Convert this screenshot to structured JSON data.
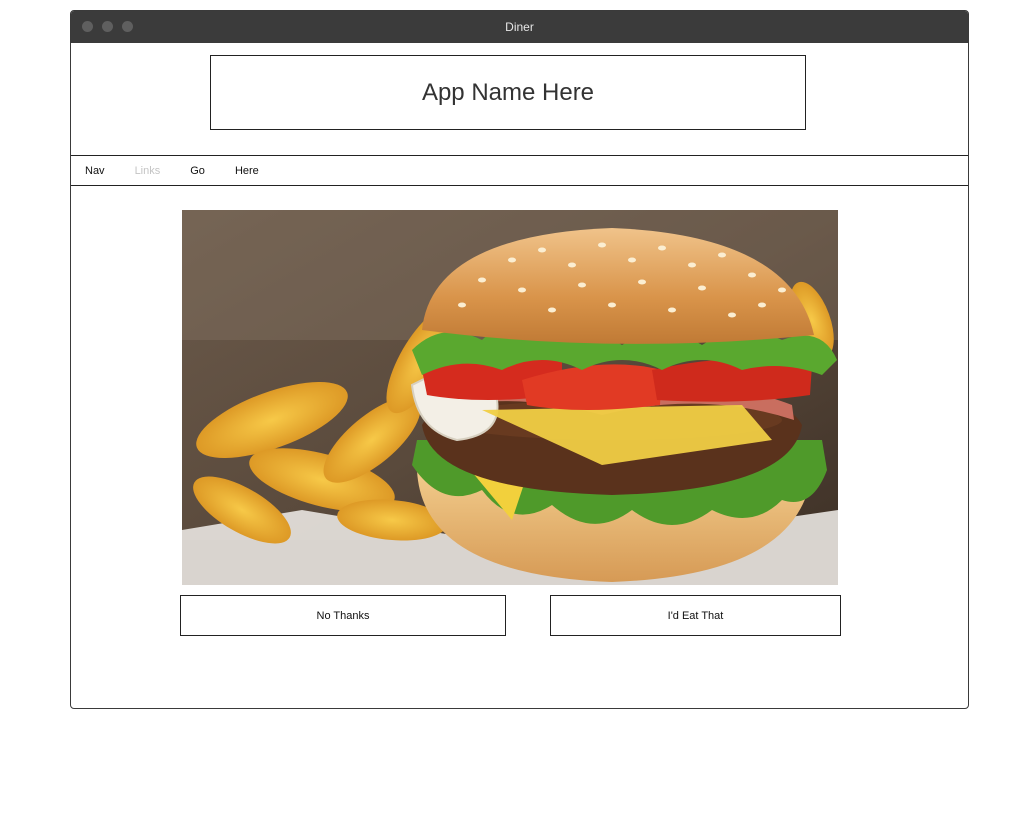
{
  "window": {
    "title": "Diner"
  },
  "header": {
    "app_name": "App Name Here"
  },
  "nav": {
    "items": [
      {
        "label": "Nav",
        "enabled": true
      },
      {
        "label": "Links",
        "enabled": false
      },
      {
        "label": "Go",
        "enabled": true
      },
      {
        "label": "Here",
        "enabled": true
      }
    ]
  },
  "main": {
    "photo_icon": "burger-and-fries-photo",
    "buttons": {
      "reject_label": "No Thanks",
      "accept_label": "I'd Eat That"
    }
  },
  "colors": {
    "titlebar": "#3b3b3b",
    "border": "#222222",
    "disabled_text": "#c4c4c4"
  }
}
